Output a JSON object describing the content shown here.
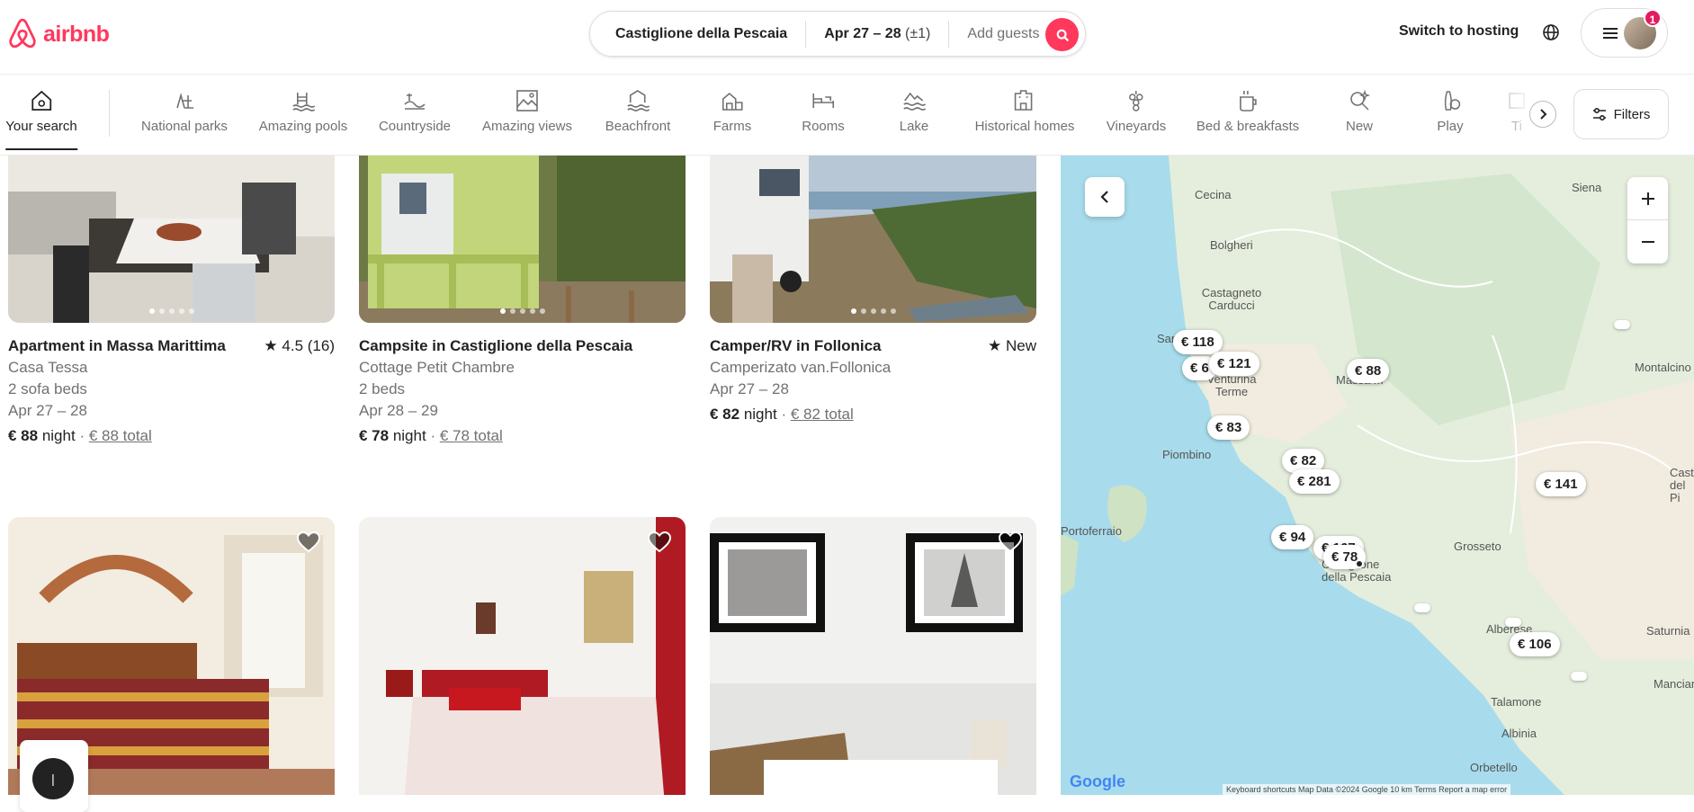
{
  "header": {
    "logo_text": "airbnb",
    "search": {
      "location": "Castiglione della Pescaia",
      "dates": "Apr 27 – 28",
      "flex": "(±1)",
      "guests_placeholder": "Add guests"
    },
    "switch_hosting": "Switch to hosting",
    "notification_count": "1"
  },
  "categories": [
    {
      "label": "Your search",
      "icon": "home-search-icon",
      "active": true
    },
    {
      "label": "National parks",
      "icon": "national-parks-icon"
    },
    {
      "label": "Amazing pools",
      "icon": "pool-icon"
    },
    {
      "label": "Countryside",
      "icon": "countryside-icon"
    },
    {
      "label": "Amazing views",
      "icon": "views-icon"
    },
    {
      "label": "Beachfront",
      "icon": "beachfront-icon"
    },
    {
      "label": "Farms",
      "icon": "farm-icon"
    },
    {
      "label": "Rooms",
      "icon": "rooms-icon"
    },
    {
      "label": "Lake",
      "icon": "lake-icon"
    },
    {
      "label": "Historical homes",
      "icon": "historical-home-icon"
    },
    {
      "label": "Vineyards",
      "icon": "vineyard-icon"
    },
    {
      "label": "Bed & breakfasts",
      "icon": "bed-breakfast-icon"
    },
    {
      "label": "New",
      "icon": "new-icon"
    },
    {
      "label": "Play",
      "icon": "play-icon"
    },
    {
      "label": "Ti",
      "icon": "partial-category-icon"
    }
  ],
  "filters_label": "Filters",
  "listings": [
    {
      "title": "Apartment in Massa Marittima",
      "rating": "4.5 (16)",
      "subtitle": "Casa Tessa",
      "beds": "2 sofa beds",
      "dates": "Apr 27 – 28",
      "price": "€ 88",
      "price_unit": "night",
      "total": "€ 88 total"
    },
    {
      "title": "Campsite in Castiglione della Pescaia",
      "rating": "",
      "subtitle": "Cottage Petit Chambre",
      "beds": "2 beds",
      "dates": "Apr 28 – 29",
      "price": "€ 78",
      "price_unit": "night",
      "total": "€ 78 total"
    },
    {
      "title": "Camper/RV in Follonica",
      "rating": "New",
      "subtitle": "Camperizato van.Follonica",
      "beds": "",
      "dates": "Apr 27 – 28",
      "price": "€ 82",
      "price_unit": "night",
      "total": "€ 82 total"
    }
  ],
  "map": {
    "pins": [
      "€ 118",
      "€ 6",
      "€ 121",
      "€ 88",
      "€ 83",
      "€ 82",
      "€ 281",
      "€ 141",
      "€ 94",
      "€ 167",
      "€ 78",
      "€ 106"
    ],
    "places": [
      "Cecina",
      "Bolgheri",
      "Castagneto Carducci",
      "San",
      "Venturina Terme",
      "Piombino",
      "Massa M",
      "Siena",
      "Montalcino",
      "Castel del Pi",
      "Portoferraio",
      "Castiglione della Pescaia",
      "Grosseto",
      "Alberese",
      "Saturnia",
      "Talamone",
      "Manciano",
      "Albinia",
      "Orbetello"
    ],
    "google": "Google",
    "attribution": "Keyboard shortcuts   Map Data ©2024 Google   10 km   Terms   Report a map error"
  },
  "colors": {
    "brand": "#ff385c",
    "text": "#222222",
    "muted": "#717171"
  }
}
